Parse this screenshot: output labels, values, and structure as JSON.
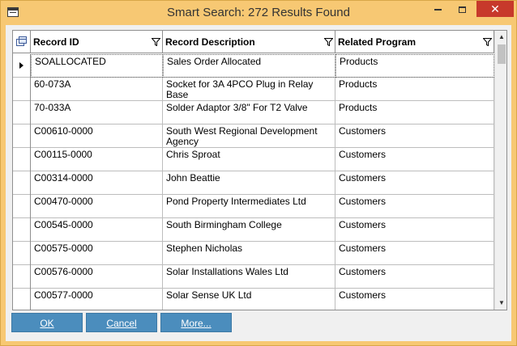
{
  "window": {
    "title": "Smart Search: 272 Results Found",
    "close_glyph": "✕"
  },
  "grid": {
    "columns": [
      {
        "label": "Record ID"
      },
      {
        "label": "Record Description"
      },
      {
        "label": "Related Program"
      }
    ],
    "rows": [
      {
        "id": "SOALLOCATED",
        "desc": "Sales Order Allocated",
        "program": "Products"
      },
      {
        "id": "60-073A",
        "desc": "Socket for 3A 4PCO Plug in Relay Base",
        "program": "Products"
      },
      {
        "id": "70-033A",
        "desc": "Solder Adaptor 3/8\" For T2 Valve",
        "program": "Products"
      },
      {
        "id": "C00610-0000",
        "desc": "South West Regional Development Agency",
        "program": "Customers"
      },
      {
        "id": "C00115-0000",
        "desc": "Chris Sproat",
        "program": "Customers"
      },
      {
        "id": "C00314-0000",
        "desc": "John Beattie",
        "program": "Customers"
      },
      {
        "id": "C00470-0000",
        "desc": "Pond Property Intermediates Ltd",
        "program": "Customers"
      },
      {
        "id": "C00545-0000",
        "desc": "South Birmingham College",
        "program": "Customers"
      },
      {
        "id": "C00575-0000",
        "desc": "Stephen Nicholas",
        "program": "Customers"
      },
      {
        "id": "C00576-0000",
        "desc": "Solar Installations Wales Ltd",
        "program": "Customers"
      },
      {
        "id": "C00577-0000",
        "desc": "Solar Sense UK Ltd",
        "program": "Customers"
      }
    ]
  },
  "buttons": {
    "ok": "OK",
    "cancel": "Cancel",
    "more": "More..."
  },
  "colors": {
    "title_bar": "#f7c873",
    "close_button": "#c7392b",
    "button": "#4b8dbd"
  }
}
